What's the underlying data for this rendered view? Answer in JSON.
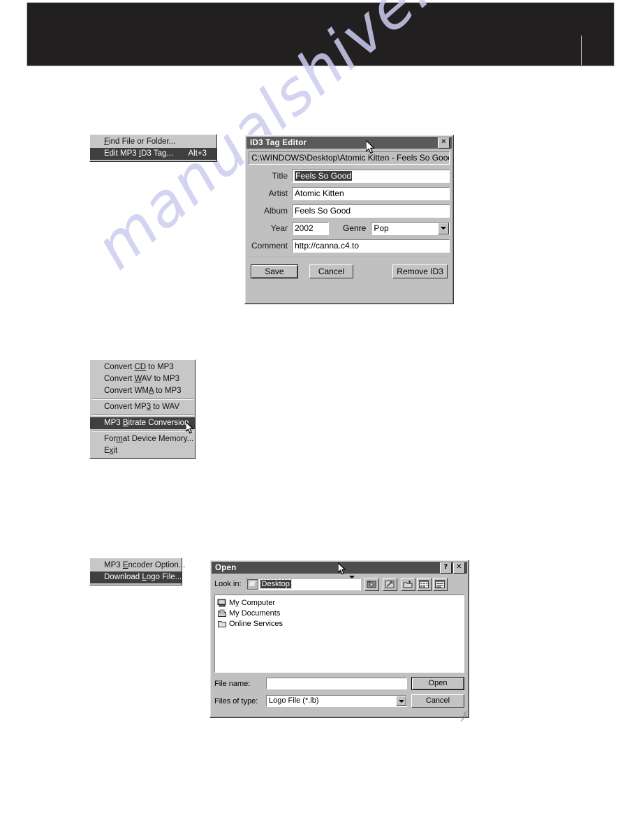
{
  "page": {
    "watermark_text": "manualshive.c",
    "background_color": "#ffffff",
    "header_color": "#221f20"
  },
  "menus": {
    "file_menu": {
      "name": "file-menu",
      "items": [
        {
          "label": "Find File or Folder...",
          "accel": "",
          "highlight": false
        },
        {
          "label": "Edit MP3 ID3 Tag...",
          "accel": "Alt+3",
          "highlight": true
        }
      ]
    },
    "convert_menu": {
      "name": "convert-menu",
      "items": [
        {
          "label": "Convert CD to MP3",
          "accel": "",
          "highlight": false,
          "separator_after": false
        },
        {
          "label": "Convert WAV to MP3",
          "accel": "",
          "highlight": false,
          "separator_after": false
        },
        {
          "label": "Convert WMA to MP3",
          "accel": "",
          "highlight": false,
          "separator_after": true
        },
        {
          "label": "Convert MP3 to WAV",
          "accel": "",
          "highlight": false,
          "separator_after": true
        },
        {
          "label": "MP3 Bitrate Conversion",
          "accel": "",
          "highlight": true,
          "separator_after": true
        },
        {
          "label": "Format Device Memory...",
          "accel": "",
          "highlight": false,
          "separator_after": false
        },
        {
          "label": "Exit",
          "accel": "",
          "highlight": false,
          "separator_after": false
        }
      ]
    },
    "options_menu": {
      "name": "options-menu",
      "items": [
        {
          "label": "MP3 Encoder Option...",
          "accel": "",
          "highlight": false
        },
        {
          "label": "Download Logo File...",
          "accel": "",
          "highlight": true
        }
      ]
    }
  },
  "id3_dialog": {
    "title": "ID3 Tag Editor",
    "close_label": "✕",
    "path": "C:\\WINDOWS\\Desktop\\Atomic Kitten - Feels So Good",
    "fields": {
      "title_label": "Title",
      "title_value": "Feels So Good",
      "artist_label": "Artist",
      "artist_value": "Atomic Kitten",
      "album_label": "Album",
      "album_value": "Feels So Good",
      "year_label": "Year",
      "year_value": "2002",
      "genre_label": "Genre",
      "genre_value": "Pop",
      "comment_label": "Comment",
      "comment_value": "http://canna.c4.to"
    },
    "buttons": {
      "save": "Save",
      "cancel": "Cancel",
      "remove": "Remove ID3"
    }
  },
  "open_dialog": {
    "title": "Open",
    "help_label": "?",
    "close_label": "✕",
    "lookin_label": "Look in:",
    "lookin_value": "Desktop",
    "toolbar_icons": [
      "up-one-level-icon",
      "look-in-favorites-icon",
      "create-new-folder-icon",
      "list-view-icon",
      "details-view-icon"
    ],
    "files": [
      {
        "name": "My Computer",
        "icon": "computer-icon"
      },
      {
        "name": "My Documents",
        "icon": "documents-folder-icon"
      },
      {
        "name": "Online Services",
        "icon": "folder-icon"
      }
    ],
    "filename_label": "File name:",
    "filename_value": "",
    "filetype_label": "Files of type:",
    "filetype_value": "Logo File (*.lb)",
    "open_button": "Open",
    "cancel_button": "Cancel"
  }
}
